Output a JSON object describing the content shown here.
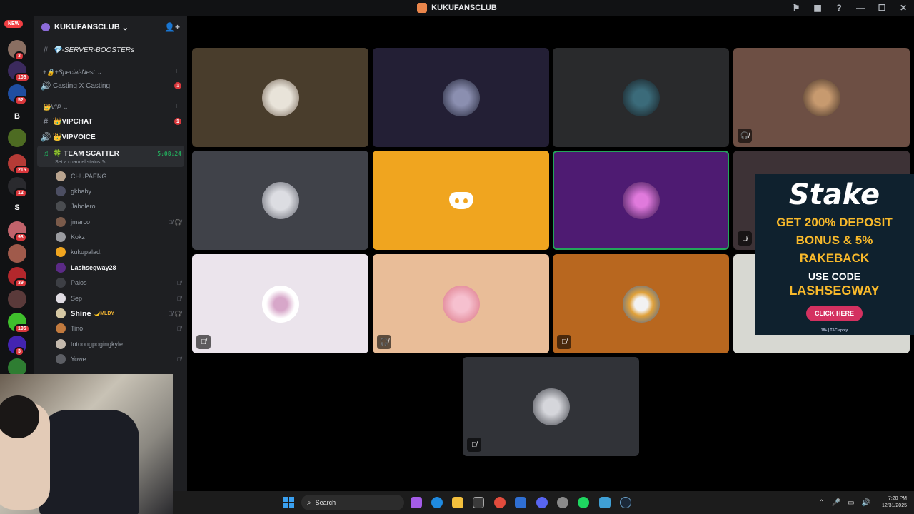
{
  "window": {
    "title": "KUKUFANSCLUB",
    "controls": [
      "⚑",
      "▣",
      "?",
      "—",
      "☐",
      "✕"
    ]
  },
  "server_rail": {
    "new_label": "NEW",
    "badges": [
      "3",
      "106",
      "52",
      "215",
      "12",
      "93",
      "39",
      "195",
      "3"
    ],
    "letters": [
      "B",
      "S"
    ]
  },
  "server": {
    "name": "KUKUFANSCLUB",
    "boosters_channel": "💎-SERVER-BOOSTERs",
    "categories": [
      {
        "label": "+🔒+Special-Nest ⌄"
      },
      {
        "label": "👑VIP ⌄"
      }
    ],
    "channels": [
      {
        "name": "Casting X Casting",
        "unread": "1"
      },
      {
        "name": "👑VIPCHAT",
        "unread": "1"
      },
      {
        "name": "👑VIPVOICE"
      },
      {
        "name": "🍀 TEAM SCATTER",
        "timer": "5:08:24",
        "status": "Set a channel status ✎"
      }
    ],
    "voice_users": [
      {
        "name": "CHUPAENG",
        "status": ""
      },
      {
        "name": "gkbaby",
        "status": ""
      },
      {
        "name": "Jabolero",
        "status": ""
      },
      {
        "name": "jmarco",
        "status": "🎙̸ 🎧̸"
      },
      {
        "name": "Kokz",
        "status": ""
      },
      {
        "name": "kukupalad.",
        "status": ""
      },
      {
        "name": "Lashsegway28",
        "status": ""
      },
      {
        "name": "Palos",
        "status": "🎙̸"
      },
      {
        "name": "Sep",
        "status": "🎙̸"
      },
      {
        "name": "𝗦𝗵𝗶𝗻𝗲",
        "tag": "🌙MLDY",
        "status": "🎙̸ 🎧̸"
      },
      {
        "name": "Tino",
        "status": "🎙̸"
      },
      {
        "name": "totoongpogingkyle",
        "status": ""
      },
      {
        "name": "Yowe",
        "status": "🎙̸"
      }
    ]
  },
  "tiles": {
    "muted_icon": "🎙̸",
    "deafened_icon": "🎧̸"
  },
  "ad": {
    "brand": "Stake",
    "offer_line1": "GET 200% DEPOSIT",
    "offer_line2": "BONUS & 5%",
    "offer_line3": "RAKEBACK",
    "use_code": "USE CODE",
    "code": "LASHSEGWAY",
    "cta": "CLICK HERE",
    "terms": "18+ | T&C apply"
  },
  "taskbar": {
    "search_placeholder": "Search",
    "time": "7:20 PM",
    "date": "12/31/2025"
  }
}
